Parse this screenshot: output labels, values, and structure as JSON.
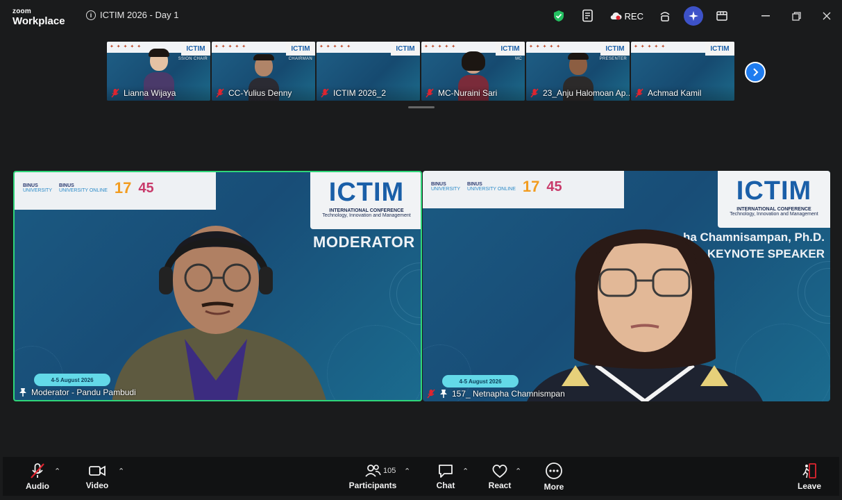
{
  "app": {
    "brand_line1": "zoom",
    "brand_line2": "Workplace",
    "meeting_title": "ICTIM 2026 - Day 1",
    "rec_label": "REC"
  },
  "strip": {
    "participants": [
      {
        "name": "Lianna Wijaya",
        "role": "SSION CHAIR"
      },
      {
        "name": "CC-Yulius Denny",
        "role": "CHAIRMAN"
      },
      {
        "name": "ICTIM 2026_2",
        "role": ""
      },
      {
        "name": "MC-Nuraini Sari",
        "role": "MC"
      },
      {
        "name": "23_Anju Halomoan Ap...",
        "role": "PRESENTER"
      },
      {
        "name": "Achmad Kamil",
        "role": ""
      }
    ],
    "ictim_mini": "ICTIM"
  },
  "tiles": {
    "left": {
      "participant": "Moderator - Pandu Pambudi",
      "role_banner": "MODERATOR",
      "date": "4-5 August 2026"
    },
    "right": {
      "participant": "157_ Netnapha Chamnismpan",
      "speaker_name": "ha Chamnisampan, Ph.D.",
      "role_banner": "KEYNOTE SPEAKER",
      "date": "4-5 August 2026"
    },
    "conference": {
      "logo": "ICTIM",
      "line1": "INTERNATIONAL CONFERENCE",
      "line2": "Technology, Innovation and Management",
      "logo_binus1": "BINUS",
      "logo_binus1_sub": "UNIVERSITY",
      "logo_binus2": "BINUS",
      "logo_binus2_sub": "UNIVERSITY ONLINE",
      "logo_17": "17",
      "logo_45": "45"
    }
  },
  "toolbar": {
    "audio": "Audio",
    "video": "Video",
    "participants": "Participants",
    "participants_count": "105",
    "chat": "Chat",
    "react": "React",
    "more": "More",
    "leave": "Leave"
  },
  "colors": {
    "accent_green": "#2fd67a",
    "brand_blue": "#1f7cef",
    "ai_purple": "#3d52c8",
    "leave_red": "#e0242f"
  }
}
